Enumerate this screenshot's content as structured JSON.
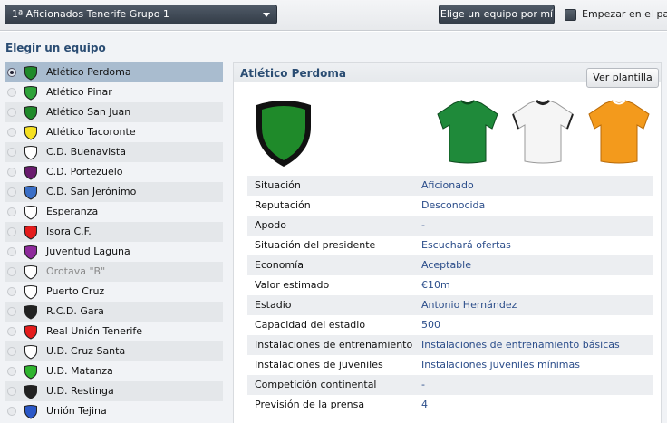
{
  "toolbar": {
    "league_value": "1ª Aficionados Tenerife Grupo 1",
    "choose_team_button": "Elige un equipo por mí",
    "start_checkbox_label": "Empezar en el paro"
  },
  "left": {
    "section_title": "Elegir un equipo",
    "teams": [
      {
        "name": "Atlético Perdoma",
        "crest_color": "#1f8a2a",
        "selected": true
      },
      {
        "name": "Atlético Pinar",
        "crest_color": "#2fa33a"
      },
      {
        "name": "Atlético San Juan",
        "crest_color": "#1f8a2a"
      },
      {
        "name": "Atlético Tacoronte",
        "crest_color": "#f5e021"
      },
      {
        "name": "C.D. Buenavista",
        "crest_color": "#ffffff"
      },
      {
        "name": "C.D. Portezuelo",
        "crest_color": "#6a1b6e"
      },
      {
        "name": "C.D. San Jerónimo",
        "crest_color": "#3a6fc7"
      },
      {
        "name": "Esperanza",
        "crest_color": "#ffffff"
      },
      {
        "name": "Isora C.F.",
        "crest_color": "#e41c1c"
      },
      {
        "name": "Juventud Laguna",
        "crest_color": "#8e2a9c"
      },
      {
        "name": "Orotava \"B\"",
        "crest_color": "#ffffff",
        "dim": true
      },
      {
        "name": "Puerto Cruz",
        "crest_color": "#ffffff"
      },
      {
        "name": "R.C.D. Gara",
        "crest_color": "#222222"
      },
      {
        "name": "Real Unión Tenerife",
        "crest_color": "#e41c1c"
      },
      {
        "name": "U.D. Cruz Santa",
        "crest_color": "#ffffff"
      },
      {
        "name": "U.D. Matanza",
        "crest_color": "#2fb52f"
      },
      {
        "name": "U.D. Restinga",
        "crest_color": "#222222"
      },
      {
        "name": "Unión Tejina",
        "crest_color": "#2b58c8"
      }
    ]
  },
  "panel": {
    "title": "Atlético Perdoma",
    "squad_button": "Ver plantilla",
    "kit_colors": {
      "home": "#1f8a3a",
      "away": "#f5f5f5",
      "third": "#f39a1c"
    },
    "details": [
      {
        "label": "Situación",
        "value": "Aficionado"
      },
      {
        "label": "Reputación",
        "value": "Desconocida"
      },
      {
        "label": "Apodo",
        "value": "-"
      },
      {
        "label": "Situación del presidente",
        "value": "Escuchará ofertas"
      },
      {
        "label": "Economía",
        "value": "Aceptable"
      },
      {
        "label": "Valor estimado",
        "value": "€10m"
      },
      {
        "label": "Estadio",
        "value": "Antonio Hernández"
      },
      {
        "label": "Capacidad del estadio",
        "value": "500"
      },
      {
        "label": "Instalaciones de entrenamiento",
        "value": "Instalaciones de entrenamiento básicas"
      },
      {
        "label": "Instalaciones de juveniles",
        "value": "Instalaciones juveniles mínimas"
      },
      {
        "label": "Competición continental",
        "value": "-"
      },
      {
        "label": "Previsión de la prensa",
        "value": "4"
      }
    ]
  }
}
